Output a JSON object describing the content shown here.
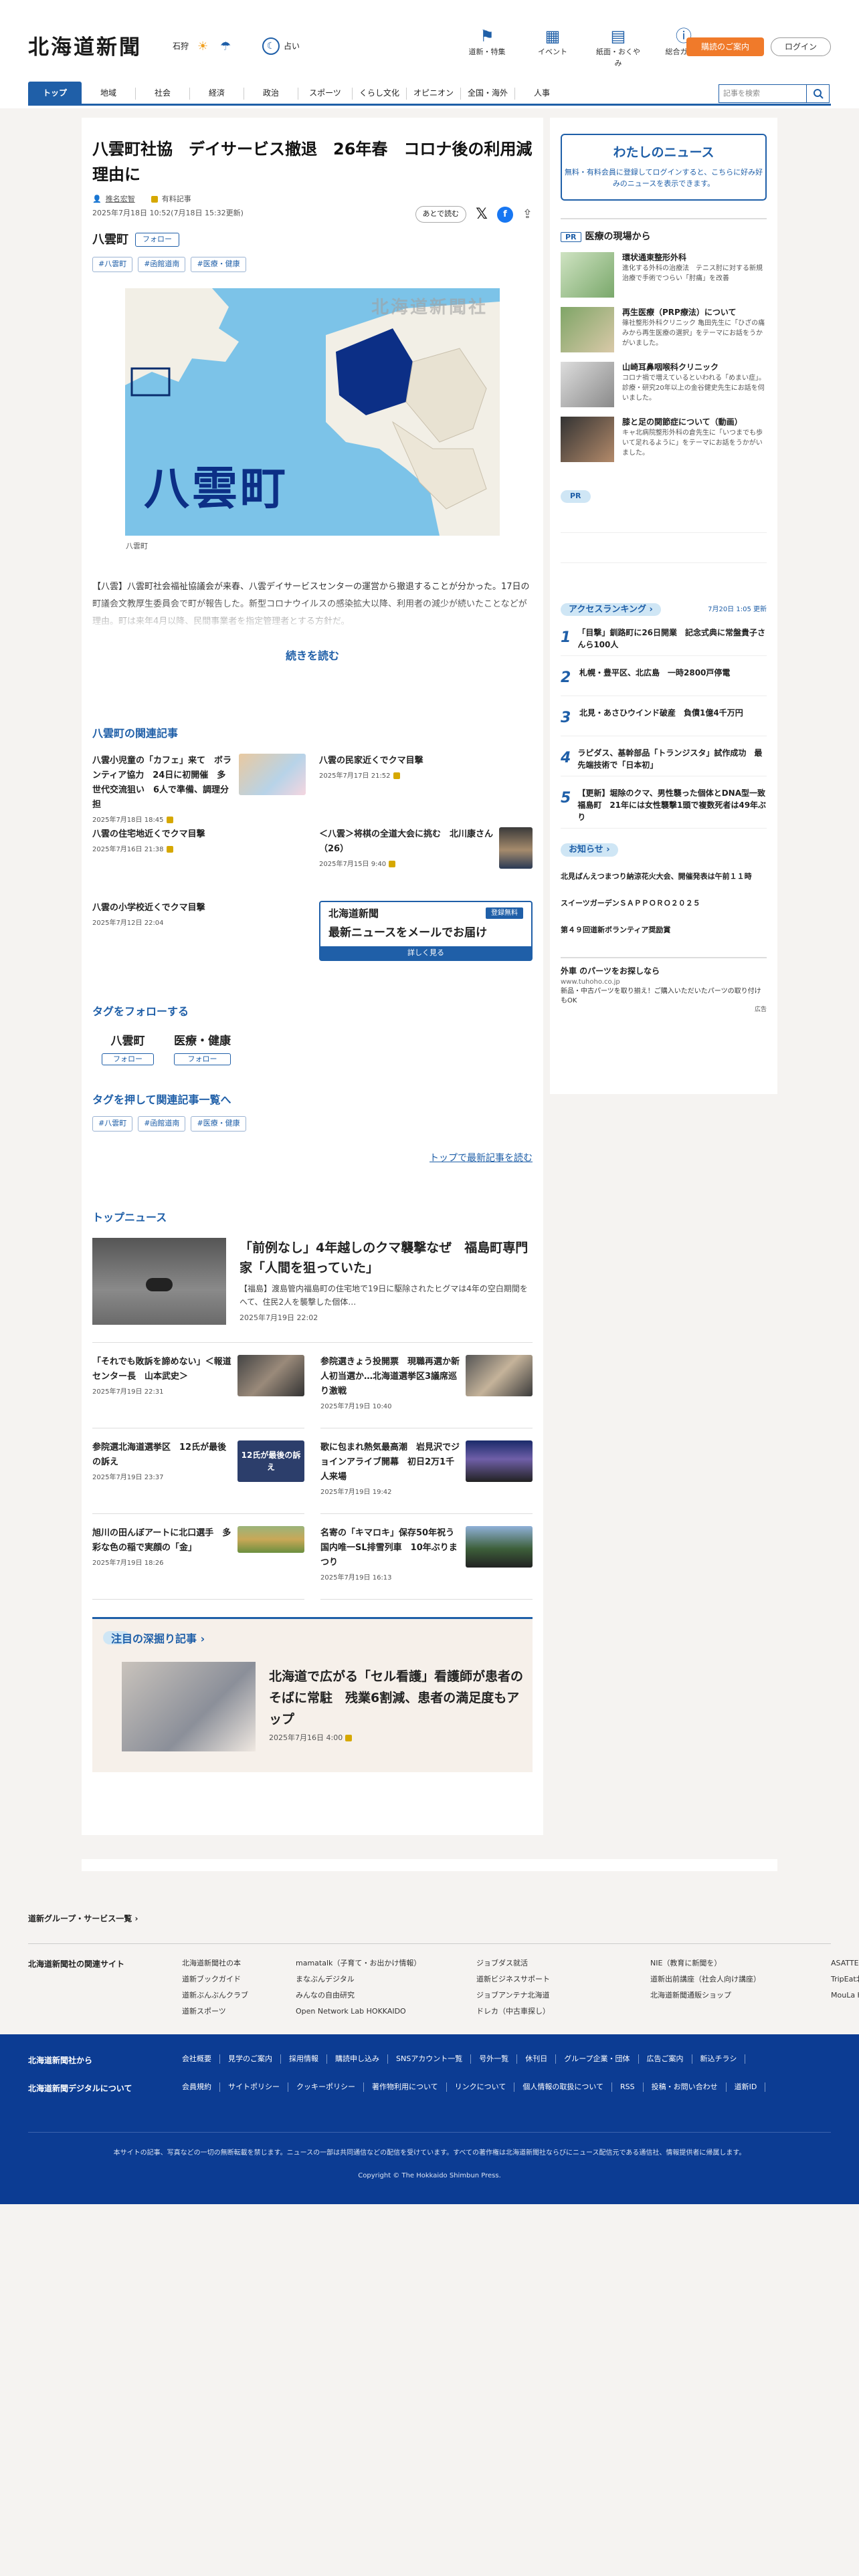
{
  "header": {
    "logo": "北海道新聞",
    "weather_city": "石狩",
    "fortune": "占い",
    "nav": [
      {
        "label": "道新・特集",
        "icon": "flag-icon"
      },
      {
        "label": "イベント",
        "icon": "calendar-icon"
      },
      {
        "label": "紙面・おくやみ",
        "icon": "newspaper-icon"
      },
      {
        "label": "総合ガイド",
        "icon": "question-icon"
      }
    ],
    "subscribe": "購読のご案内",
    "login": "ログイン",
    "search_placeholder": "記事を検索",
    "tabs": [
      "トップ",
      "地域",
      "社会",
      "経済",
      "政治",
      "スポーツ",
      "くらし文化",
      "オピニオン",
      "全国・海外",
      "人事"
    ]
  },
  "article": {
    "title": "八雲町社協　デイサービス撤退　26年春　コロナ後の利用減理由に",
    "author": "推名宏智",
    "badge": "有料記事",
    "date": "2025年7月18日 10:52(7月18日 15:32更新)",
    "later": "あとで読む",
    "place": "八雲町",
    "follow": "フォロー",
    "tags": [
      "#八雲町",
      "#函館道南",
      "#医療・健康"
    ],
    "map_label": "八雲町",
    "map_watermark": "北海道新聞社",
    "caption": "八雲町",
    "body": "【八雲】八雲町社会福祉協議会が来春、八雲デイサービスセンターの運営から撤退することが分かった。17日の町議会文教厚生委員会で町が報告した。新型コロナウイルスの感染拡大以降、利用者の減少が続いたことなどが理由。町は来年4月以降、民間事業者を指定管理者とする方針だ。",
    "more": "続きを読む"
  },
  "related": {
    "heading": "八雲町の関連記事",
    "items": [
      {
        "title": "八雲小児童の「カフェ」来て　ボランティア協力　24日に初開催　多世代交流狙い　6人で準備、調理分担",
        "date": "2025年7月18日 18:45",
        "lock": true
      },
      {
        "title": "八雲の民家近くでクマ目撃",
        "date": "2025年7月17日 21:52",
        "lock": true
      },
      {
        "title": "八雲の住宅地近くでクマ目撃",
        "date": "2025年7月16日 21:38",
        "lock": true
      },
      {
        "title": "＜八雲＞将棋の全道大会に挑む　北川康さん（26）",
        "date": "2025年7月15日 9:40",
        "lock": true
      },
      {
        "title": "八雲の小学校近くでクマ目撃",
        "date": "2025年7月12日 22:04",
        "lock": false
      }
    ],
    "mail_logo": "北海道新聞",
    "mail_badge": "登録無料",
    "mail_text": "最新ニュースをメールでお届け",
    "mail_bar": "詳しく見る"
  },
  "follow_tags": {
    "heading": "タグをフォローする",
    "items": [
      {
        "name": "八雲町",
        "btn": "フォロー"
      },
      {
        "name": "医療・健康",
        "btn": "フォロー"
      }
    ],
    "push_heading": "タグを押して関連記事一覧へ",
    "tags": [
      "#八雲町",
      "#函館道南",
      "#医療・健康"
    ],
    "top_link": "トップで最新記事を読む"
  },
  "top_news": {
    "heading": "トップニュース",
    "lead": {
      "title": "「前例なし」4年越しのクマ襲撃なぜ　福島町専門家「人間を狙っていた」",
      "summary": "【福島】渡島管内福島町の住宅地で19日に駆除されたヒグマは4年の空白期間をへて、住民2人を襲撃した個体…",
      "date": "2025年7月19日 22:02"
    },
    "items": [
      {
        "title": "「それでも敗訴を諦めない」＜報道センター長　山本武史＞",
        "date": "2025年7月19日 22:31"
      },
      {
        "title": "参院選きょう投開票　現職再選か新人初当選か…北海道選挙区3議席巡り激戦",
        "date": "2025年7月19日 10:40"
      },
      {
        "title": "参院選北海道選挙区　12氏が最後の訴え",
        "date": "2025年7月19日 23:37"
      },
      {
        "title": "歌に包まれ熱気最高潮　岩見沢でジョインアライブ開幕　初日2万1千人来場",
        "date": "2025年7月19日 19:42"
      },
      {
        "title": "旭川の田んぼアートに北口選手　多彩な色の稲で実顔の「金」",
        "date": "2025年7月19日 18:26"
      },
      {
        "title": "名寄の「キマロキ」保存50年祝う　国内唯一SL排雪列車　10年ぶりまつり",
        "date": "2025年7月19日 16:13"
      }
    ],
    "thumb_text": "12氏が最後の訴え"
  },
  "deep": {
    "heading": "注目の深掘り記事",
    "title": "北海道で広がる「セル看護」看護師が患者のそばに常駐　残業6割減、患者の満足度もアップ",
    "date": "2025年7月16日 4:00"
  },
  "side": {
    "mynews_title": "わたしのニュース",
    "mynews_text": "無料・有料会員に登録してログインすると、こちらに好み好みのニュースを表示できます。",
    "pr_badge": "PR",
    "pr_heading": "医療の現場から",
    "pr_items": [
      {
        "title": "環状通東整形外科",
        "sub": "進化する外科の治療法　テニス肘に対する新規治療で手術でつらい「肘痛」を改善"
      },
      {
        "title": "再生医療（PRP療法）について",
        "sub": "篠社整形外科クリニック 亀田先生に「ひざの痛みから再生医療の選択」をテーマにお話をうかがいました。"
      },
      {
        "title": "山崎耳鼻咽喉科クリニック",
        "sub": "コロナ禍で増えているといわれる「めまい症」。診療・研究20年以上の金谷健史先生にお話を伺いました。"
      },
      {
        "title": "膝と足の関節症について（動画）",
        "sub": "キャ北病院整形外科の倉先生に「いつまでも歩いて足れるように」をテーマにお話をうかがいました。"
      }
    ],
    "pr2": "PR",
    "ranking_title": "アクセスランキング",
    "ranking_updated": "7月20日 1:05 更新",
    "ranking": [
      {
        "n": "1",
        "t": "「目撃」釧路町に26日開業　記念式典に常盤貴子さんら100人"
      },
      {
        "n": "2",
        "t": "札幌・豊平区、北広島　一時2800戸停電"
      },
      {
        "n": "3",
        "t": "北見・あさひウインド破産　負債1億4千万円"
      },
      {
        "n": "4",
        "t": "ラピダス、基幹部品「トランジスタ」試作成功　最先端技術で「日本初」"
      },
      {
        "n": "5",
        "t": "【更新】堀除のクマ、男性襲った個体とDNA型一致　福島町　21年には女性襲撃1頭で複数死者は49年ぶり"
      }
    ],
    "notice_title": "お知らせ",
    "notices": [
      "北見ばんえつまつり納涼花火大会、開催発表は午前１１時",
      "スイーツガーデンＳＡＰＰＯＲＯ２０２５",
      "第４９回道新ボランティア奨励賞"
    ],
    "ad_title": "外車 のパーツをお探しなら",
    "ad_url": "www.tuhoho.co.jp",
    "ad_text": "新品・中古パーツを取り揃え！ご購入いただいたパーツの取り付けもOK",
    "ad_mark": "広告"
  },
  "footer": {
    "group": "道新グループ・サービス一覧",
    "related_title": "北海道新聞社の関連サイト",
    "related_cols": [
      [
        "北海道新聞社の本",
        "道新ブックガイド",
        "道新ぶんぶんクラブ",
        "道新スポーツ"
      ],
      [
        "mamatalk（子育て・お出かけ情報）",
        "まなぶんデジタル",
        "みんなの自由研究",
        "Open Network Lab HOKKAIDO"
      ],
      [
        "ジョブダス就活",
        "道新ビジネスサポート",
        "ジョブアンテナ北海道",
        "ドレカ（中古車探し）"
      ],
      [
        "NIE（教育に新聞を）",
        "道新出前講座（社会人向け講座）",
        "北海道新聞通販ショップ"
      ],
      [
        "ASATTE CAMP",
        "TripEat北海道",
        "MouLa HOKKAIDO"
      ]
    ],
    "k1": "北海道新聞社から",
    "k2": "北海道新聞デジタルについて",
    "row1": [
      "会社概要",
      "見学のご案内",
      "採用情報",
      "購読申し込み",
      "SNSアカウント一覧",
      "号外一覧",
      "休刊日",
      "グループ企業・団体",
      "広告ご案内",
      "新込チラシ"
    ],
    "row2": [
      "会員規約",
      "サイトポリシー",
      "クッキーポリシー",
      "著作物利用について",
      "リンクについて",
      "個人情報の取扱について",
      "RSS",
      "投稿・お問い合わせ",
      "道新ID"
    ],
    "note": "本サイトの記事、写真などの一切の無断転載を禁じます。ニュースの一部は共同通信などの配信を受けています。すべての著作権は北海道新聞社ならびにニュース配信元である通信社、情報提供者に帰属します。",
    "copyright": "Copyright © The Hokkaido Shimbun Press."
  }
}
